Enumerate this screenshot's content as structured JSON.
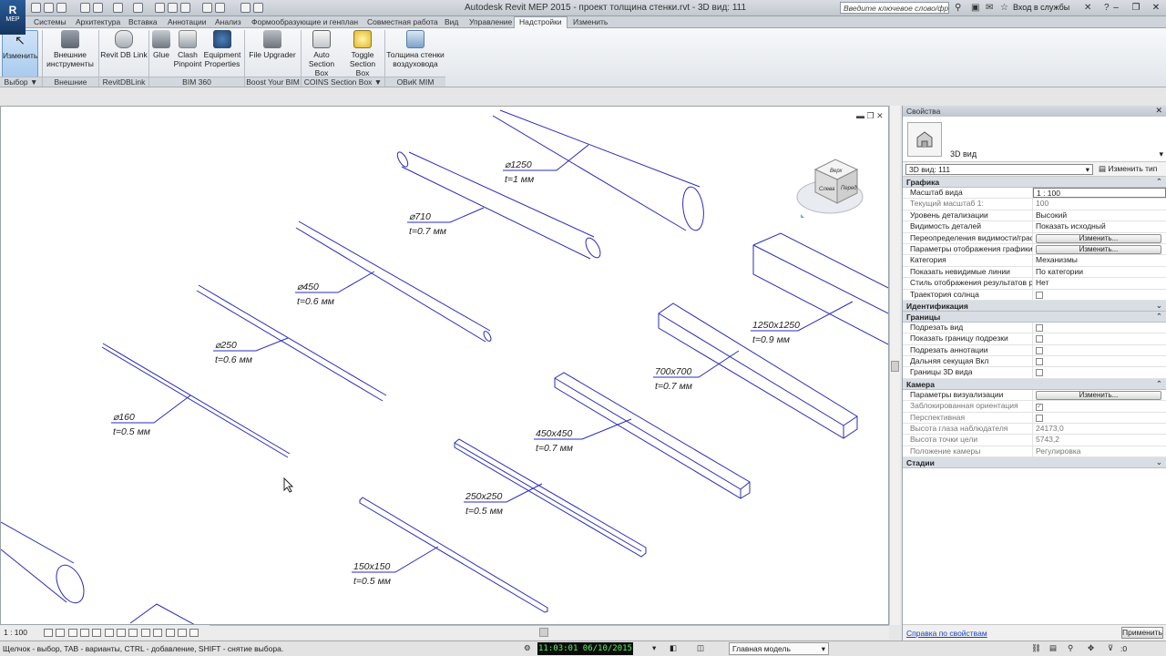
{
  "app": {
    "logo": "R",
    "logo_sub": "MEP",
    "window_title": "Autodesk Revit MEP 2015 -   проект толщина стенки.rvt - 3D вид: 111"
  },
  "search": {
    "placeholder": "Введите ключевое слово/фразу"
  },
  "account": {
    "sign_in": "Вход в службы"
  },
  "tabs": [
    {
      "label": "Системы"
    },
    {
      "label": "Архитектура"
    },
    {
      "label": "Вставка"
    },
    {
      "label": "Аннотации"
    },
    {
      "label": "Анализ"
    },
    {
      "label": "Формообразующие и генплан"
    },
    {
      "label": "Совместная работа"
    },
    {
      "label": "Вид"
    },
    {
      "label": "Управление"
    },
    {
      "label": "Надстройки"
    },
    {
      "label": "Изменить"
    }
  ],
  "ribbon": {
    "buttons": [
      {
        "label": "Изменить"
      },
      {
        "label": "Внешние инструменты"
      },
      {
        "label": "Revit DB Link"
      },
      {
        "label": "Glue"
      },
      {
        "label": "Clash Pinpoint"
      },
      {
        "label": "Equipment Properties"
      },
      {
        "label": "File Upgrader"
      },
      {
        "label": "Auto Section Box"
      },
      {
        "label": "Toggle Section Box"
      },
      {
        "label": "Толщина стенки воздуховода"
      }
    ],
    "panels": [
      {
        "label": "Выбор ▼"
      },
      {
        "label": "Внешние"
      },
      {
        "label": "RevitDBLink"
      },
      {
        "label": "BIM 360"
      },
      {
        "label": "Boost Your BIM"
      },
      {
        "label": "COINS Section Box ▼"
      },
      {
        "label": "ОВиК MIM"
      }
    ]
  },
  "viewcube": {
    "top": "Верх",
    "left": "Слева",
    "front": "Перед"
  },
  "annotations": [
    {
      "size": "⌀1250",
      "thk": "t=1 мм"
    },
    {
      "size": "⌀710",
      "thk": "t=0.7 мм"
    },
    {
      "size": "⌀450",
      "thk": "t=0.6 мм"
    },
    {
      "size": "⌀250",
      "thk": "t=0.6 мм"
    },
    {
      "size": "⌀160",
      "thk": "t=0.5 мм"
    },
    {
      "size": "1250x1250",
      "thk": "t=0.9 мм"
    },
    {
      "size": "700x700",
      "thk": "t=0.7 мм"
    },
    {
      "size": "450x450",
      "thk": "t=0.7 мм"
    },
    {
      "size": "250x250",
      "thk": "t=0.5 мм"
    },
    {
      "size": "150x150",
      "thk": "t=0.5 мм"
    }
  ],
  "view_bar": {
    "scale": "1 : 100"
  },
  "status": {
    "hint": "Щелчок - выбор, TAB - варианты, CTRL - добавление, SHIFT - снятие выбора.",
    "clock": "11:03:01  06/10/2015",
    "model": "Главная модель",
    "selection_count": ":0"
  },
  "properties": {
    "title": "Свойства",
    "type_name": "3D вид",
    "instance": "3D вид: 111",
    "edit_type": "Изменить тип",
    "groups": [
      {
        "name": "Графика",
        "rows": [
          {
            "k": "Масштаб вида",
            "v": "1 : 100",
            "kind": "input"
          },
          {
            "k": "Текущий масштаб   1:",
            "v": "100",
            "kind": "dim"
          },
          {
            "k": "Уровень детализации",
            "v": "Высокий"
          },
          {
            "k": "Видимость деталей",
            "v": "Показать исходный"
          },
          {
            "k": "Переопределения видимости/граф...",
            "v": "Изменить...",
            "kind": "button"
          },
          {
            "k": "Параметры отображения графики",
            "v": "Изменить...",
            "kind": "button"
          },
          {
            "k": "Категория",
            "v": "Механизмы"
          },
          {
            "k": "Показать невидимые линии",
            "v": "По категории"
          },
          {
            "k": "Стиль отображения результатов ра...",
            "v": "Нет"
          },
          {
            "k": "Траектория солнца",
            "v": "",
            "kind": "check"
          }
        ]
      },
      {
        "name": "Идентификация",
        "rows": []
      },
      {
        "name": "Границы",
        "rows": [
          {
            "k": "Подрезать вид",
            "v": "",
            "kind": "check"
          },
          {
            "k": "Показать границу подрезки",
            "v": "",
            "kind": "check"
          },
          {
            "k": "Подрезать аннотации",
            "v": "",
            "kind": "check"
          },
          {
            "k": "Дальняя секущая Вкл",
            "v": "",
            "kind": "check"
          },
          {
            "k": "Границы 3D вида",
            "v": "",
            "kind": "check"
          }
        ]
      },
      {
        "name": "Камера",
        "rows": [
          {
            "k": "Параметры визуализации",
            "v": "Изменить...",
            "kind": "button"
          },
          {
            "k": "Заблокированная ориентация",
            "v": "✓",
            "kind": "checkdim"
          },
          {
            "k": "Перспективная",
            "v": "",
            "kind": "checkdim"
          },
          {
            "k": "Высота глаза наблюдателя",
            "v": "24173,0",
            "kind": "dim"
          },
          {
            "k": "Высота точки цели",
            "v": "5743,2",
            "kind": "dim"
          },
          {
            "k": "Положение камеры",
            "v": "Регулировка",
            "kind": "dim"
          }
        ]
      },
      {
        "name": "Стадии",
        "rows": []
      }
    ],
    "help": "Справка по свойствам",
    "apply": "Применить"
  }
}
